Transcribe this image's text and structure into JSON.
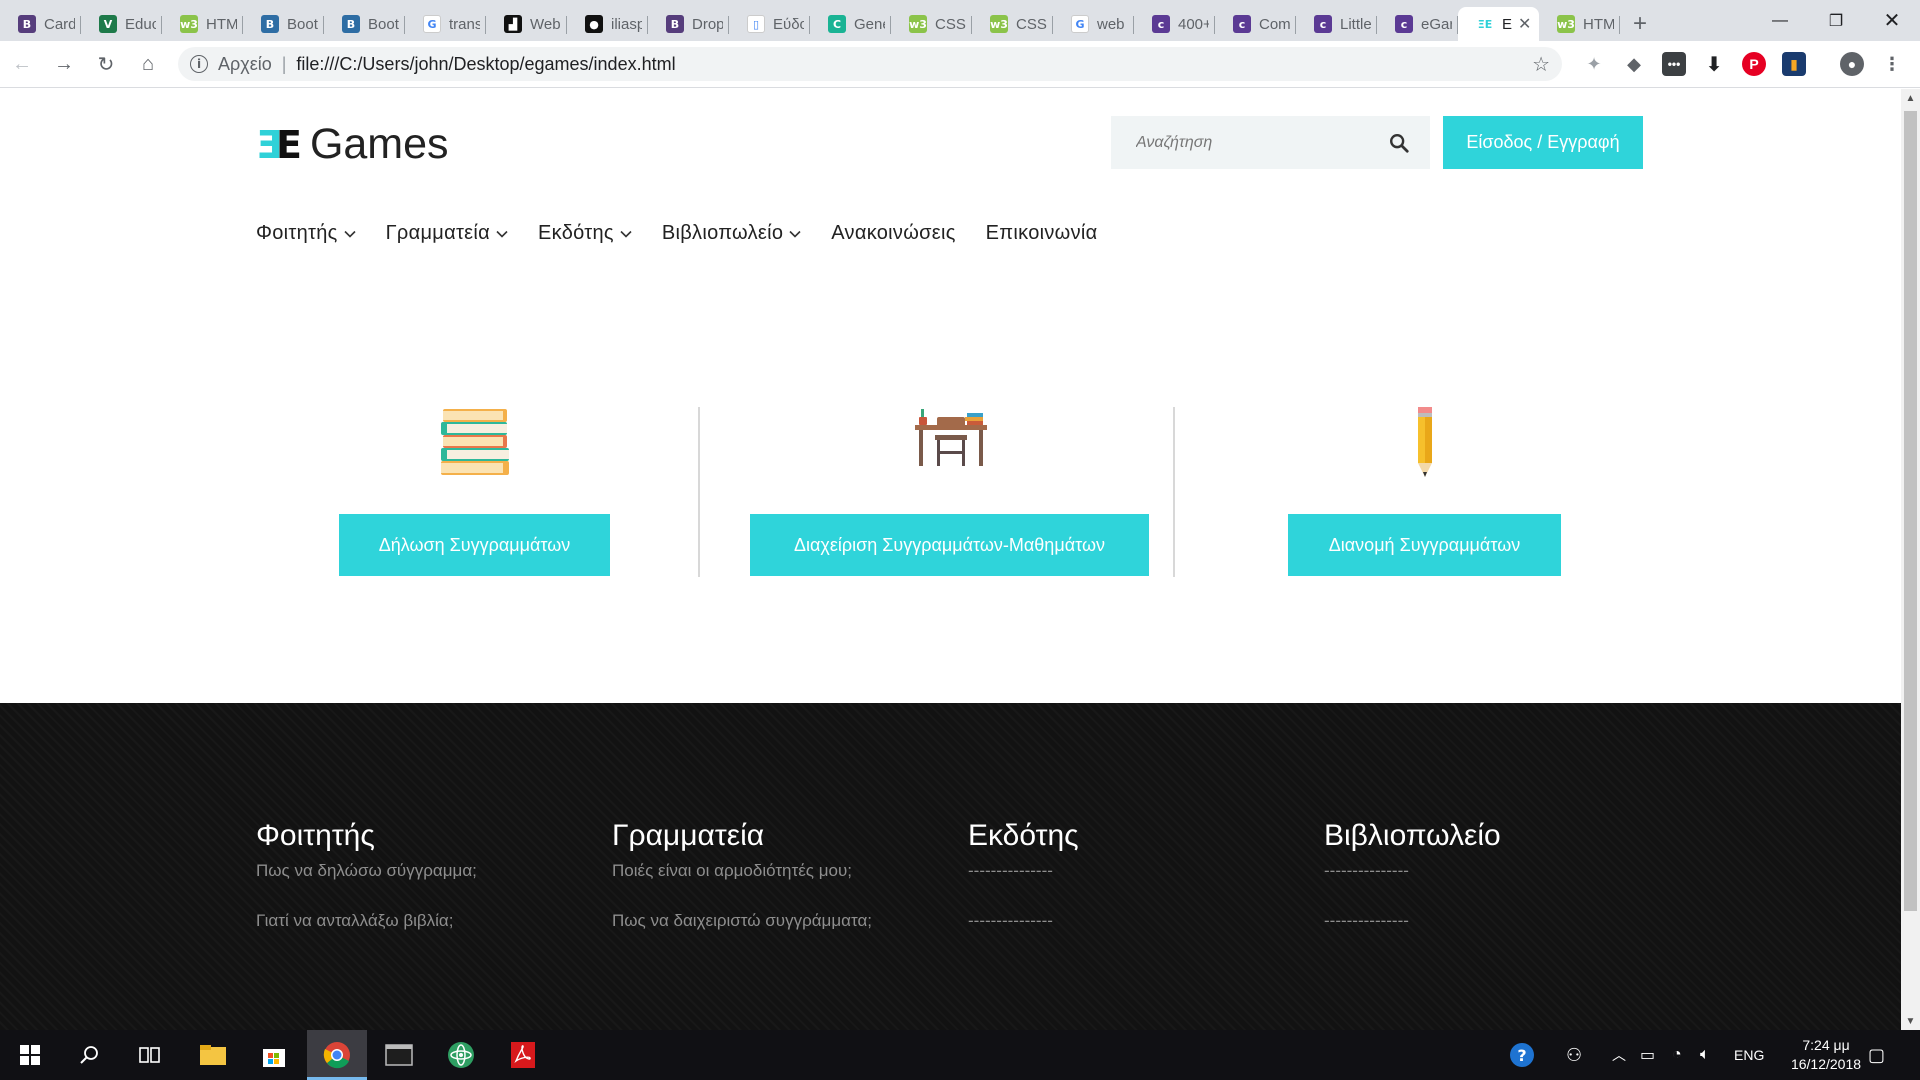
{
  "browser": {
    "tabs": [
      {
        "title": "Card",
        "icon": "bootstrap-icon",
        "color": "#563d7c",
        "glyph": "B"
      },
      {
        "title": "Educ",
        "icon": "vue-icon",
        "color": "#1e7a4a",
        "glyph": "V"
      },
      {
        "title": "HTM",
        "icon": "w3schools-icon",
        "color": "#8bc34a",
        "glyph": "w3"
      },
      {
        "title": "Boot",
        "icon": "bootsnipp-icon",
        "color": "#2e6da4",
        "glyph": "B"
      },
      {
        "title": "Boot",
        "icon": "bootsnipp-icon",
        "color": "#2e6da4",
        "glyph": "B"
      },
      {
        "title": "trans",
        "icon": "google-icon",
        "color": "#ffffff",
        "glyph": "G"
      },
      {
        "title": "Web",
        "icon": "web-icon",
        "color": "#111111",
        "glyph": "▟"
      },
      {
        "title": "iliasp",
        "icon": "github-icon",
        "color": "#111111",
        "glyph": "●"
      },
      {
        "title": "Drop",
        "icon": "bootstrap-icon",
        "color": "#563d7c",
        "glyph": "B"
      },
      {
        "title": "Εύδο",
        "icon": "page-icon",
        "color": "#ffffff",
        "glyph": "▯"
      },
      {
        "title": "Gene",
        "icon": "generator-icon",
        "color": "#1ab394",
        "glyph": "C"
      },
      {
        "title": "CSS",
        "icon": "w3schools-icon",
        "color": "#8bc34a",
        "glyph": "w3"
      },
      {
        "title": "CSS",
        "icon": "w3schools-icon",
        "color": "#8bc34a",
        "glyph": "w3"
      },
      {
        "title": "web",
        "icon": "google-icon",
        "color": "#ffffff",
        "glyph": "G"
      },
      {
        "title": "400+",
        "icon": "colorlib-icon",
        "color": "#5b3a94",
        "glyph": "c"
      },
      {
        "title": "Com",
        "icon": "colorlib-icon",
        "color": "#5b3a94",
        "glyph": "c"
      },
      {
        "title": "Little",
        "icon": "colorlib-icon",
        "color": "#5b3a94",
        "glyph": "c"
      },
      {
        "title": "eGar",
        "icon": "colorlib-icon",
        "color": "#5b3a94",
        "glyph": "c"
      },
      {
        "title": "E",
        "icon": "egames-icon",
        "color": "#2fd1d8",
        "glyph": "ΞE",
        "active": true
      },
      {
        "title": "HTM",
        "icon": "w3schools-icon",
        "color": "#8bc34a",
        "glyph": "w3"
      }
    ],
    "url_scheme_label": "Αρχείο",
    "url": "file:///C:/Users/john/Desktop/egames/index.html"
  },
  "site": {
    "logo_text": "Games",
    "search_placeholder": "Αναζήτηση",
    "login_label": "Είσοδος / Εγγραφή",
    "accent_color": "#2fd4da",
    "menu": [
      {
        "label": "Φοιτητής",
        "dropdown": true
      },
      {
        "label": "Γραμματεία",
        "dropdown": true
      },
      {
        "label": "Εκδότης",
        "dropdown": true
      },
      {
        "label": "Βιβλιοπωλείο",
        "dropdown": true
      },
      {
        "label": "Ανακοινώσεις",
        "dropdown": false
      },
      {
        "label": "Επικοινωνία",
        "dropdown": false
      }
    ],
    "actions": [
      {
        "icon": "books-stack-icon",
        "label": "Δήλωση Συγγραμμάτων"
      },
      {
        "icon": "school-desk-icon",
        "label": "Διαχείριση Συγγραμμάτων-Μαθημάτων"
      },
      {
        "icon": "pencil-icon",
        "label": "Διανομή Συγγραμμάτων"
      }
    ],
    "footer": [
      {
        "title": "Φοιτητής",
        "links": [
          "Πως να δηλώσω σύγγραμμα;",
          "Γιατί να ανταλλάξω βιβλία;"
        ]
      },
      {
        "title": "Γραμματεία",
        "links": [
          "Ποιές είναι οι αρμοδιότητές μου;",
          "Πως να δαιχειριστώ συγγράμματα;"
        ]
      },
      {
        "title": "Εκδότης",
        "links": [
          "---------------",
          "---------------"
        ]
      },
      {
        "title": "Βιβλιοπωλείο",
        "links": [
          "---------------",
          "---------------"
        ]
      }
    ]
  },
  "taskbar": {
    "language": "ENG",
    "time": "7:24 μμ",
    "date": "16/12/2018"
  }
}
